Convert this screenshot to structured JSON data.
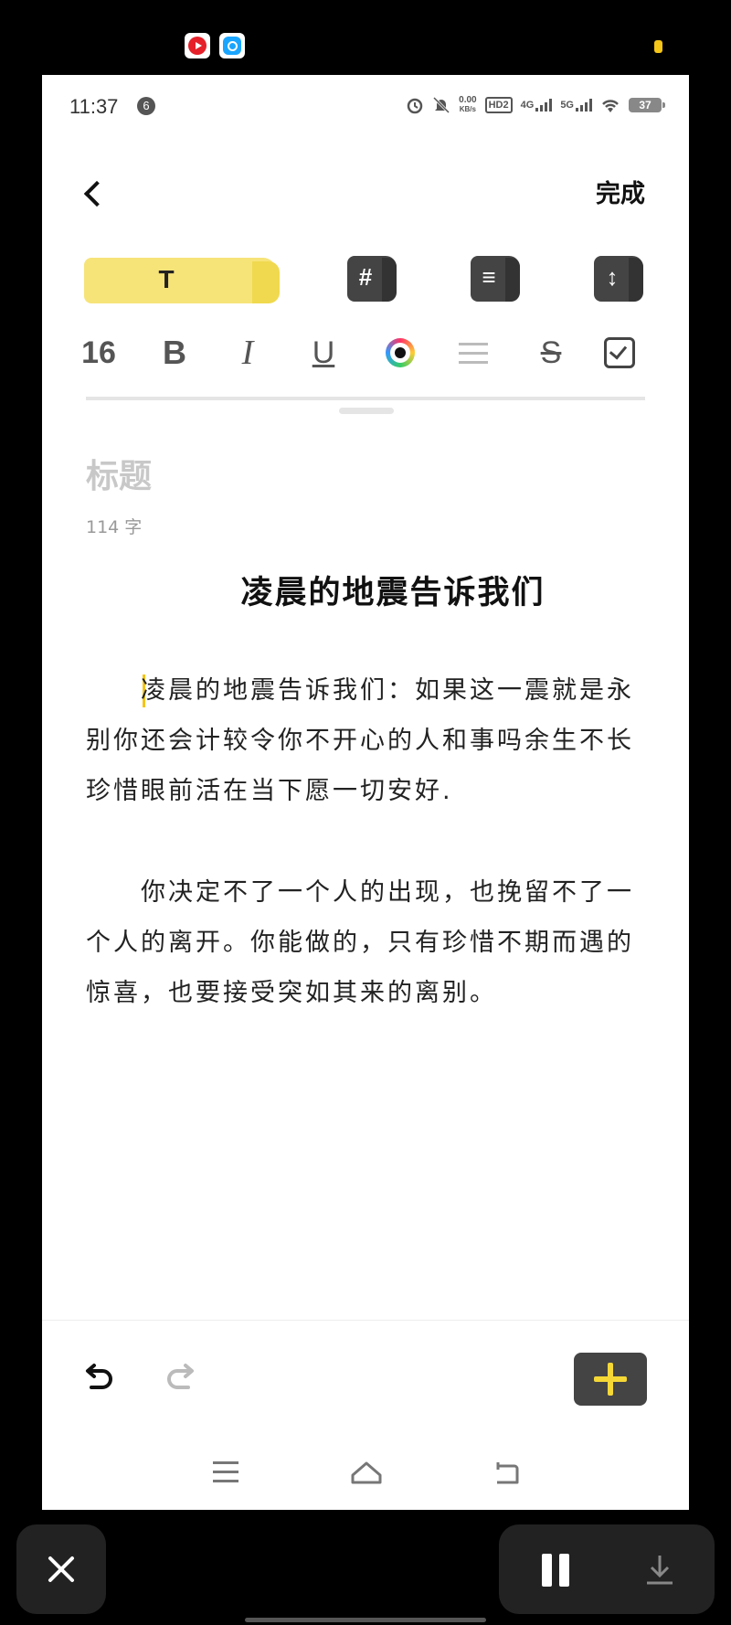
{
  "status_bar": {
    "time": "11:37",
    "notification_count": "6",
    "net_speed_value": "0.00",
    "net_speed_unit": "KB/s",
    "hd_label": "HD2",
    "signal_4g": "4G",
    "signal_5g": "5G",
    "battery": "37"
  },
  "header": {
    "done_label": "完成"
  },
  "mode_tabs": {
    "text_label": "T",
    "hashtag_glyph": "#",
    "list_glyph": "≡",
    "checklist_glyph": "↕"
  },
  "format_toolbar": {
    "font_size": "16",
    "bold": "B",
    "italic": "I",
    "underline": "U",
    "strikethrough": "S",
    "text_color": "#111111"
  },
  "editor": {
    "title_placeholder": "标题",
    "word_count": "114 字",
    "heading": "凌晨的地震告诉我们",
    "paragraphs": [
      "凌晨的地震告诉我们：如果这一震就是永别你还会计较令你不开心的人和事吗余生不长 珍惜眼前活在当下愿一切安好.",
      "你决定不了一个人的出现，也挽留不了一个人的离开。你能做的，只有珍惜不期而遇的惊喜，也要接受突如其来的离别。"
    ]
  },
  "colors": {
    "accent_yellow": "#f7e479",
    "dark_block": "#444444"
  }
}
